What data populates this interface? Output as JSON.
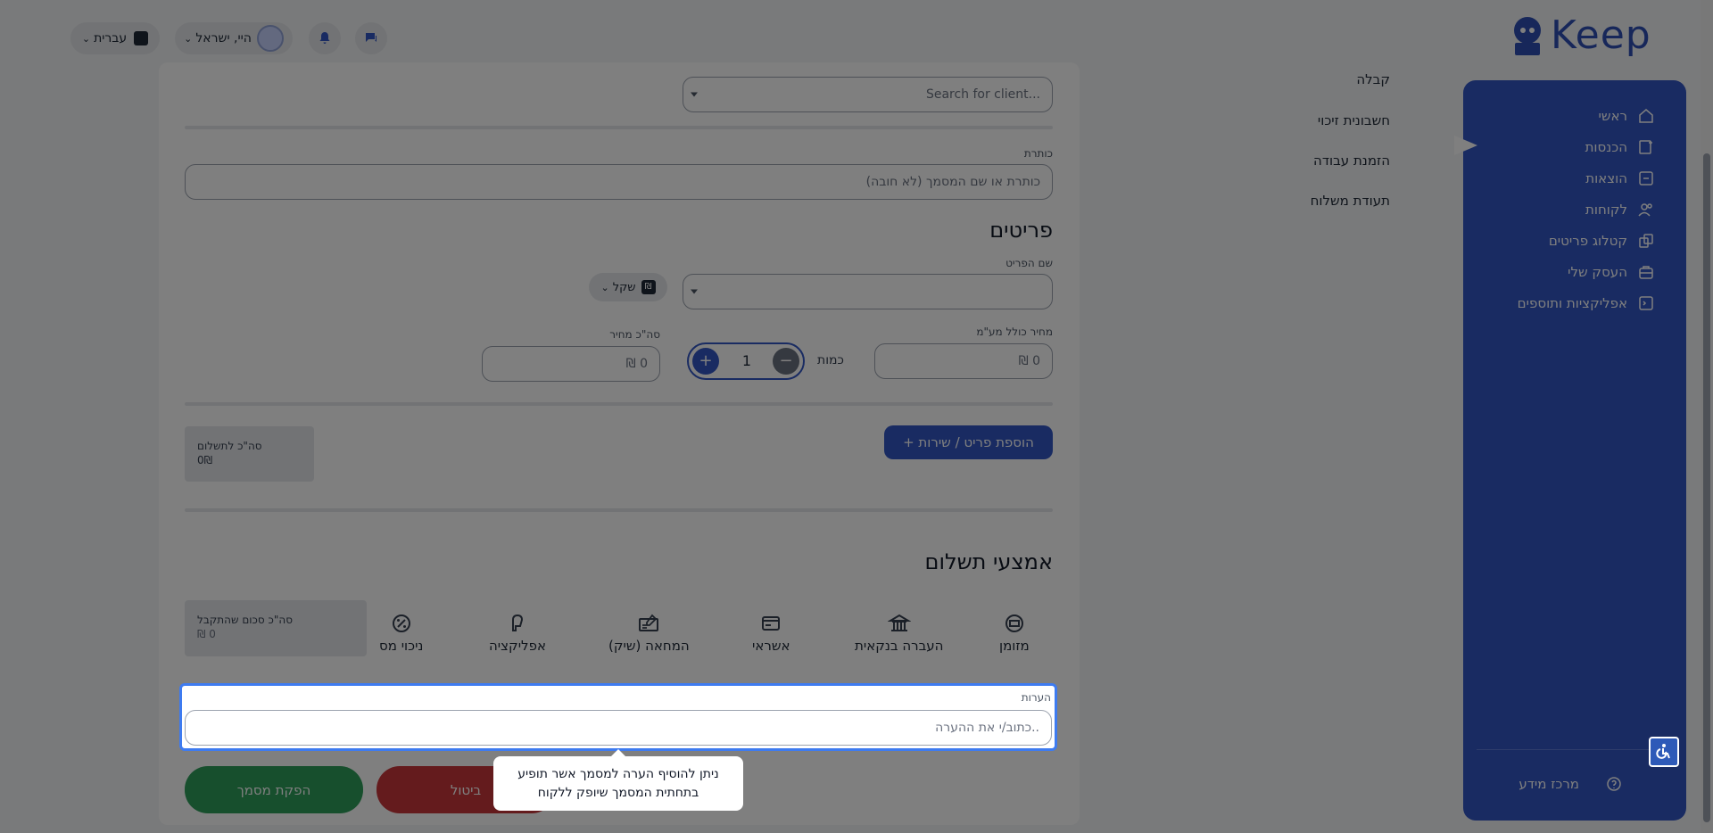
{
  "topbar": {
    "language_label": "עברית",
    "user_name": "היי, ישראל"
  },
  "brand": {
    "logo_text": "Keep"
  },
  "doc_types": [
    "קבלה",
    "חשבונית זיכוי",
    "הזמנת עבודה",
    "תעודת משלוח"
  ],
  "client": {
    "search_placeholder": "Search for client..."
  },
  "title_field": {
    "label": "כותרת",
    "placeholder": "(לא חובה) כותרת או שם המסמך"
  },
  "items": {
    "heading": "פריטים",
    "name_label": "שם הפריט",
    "currency_label": "שקל",
    "price_label": "מחיר כולל מע\"מ",
    "price_value": "₪ 0",
    "quantity_label": "כמות",
    "quantity_value": "1",
    "total_label": "סה\"כ מחיר",
    "total_value": "₪ 0",
    "add_button": "+ הוספת פריט / שירות",
    "sum_label": "סה\"כ לתשלום",
    "sum_value": "0₪"
  },
  "payment": {
    "heading": "אמצעי תשלום",
    "methods": [
      "מזומן",
      "העברה בנקאית",
      "אשראי",
      "המחאה (שיק)",
      "אפליקציה",
      "ניכוי מס"
    ],
    "received_label": "סה\"כ סכום שהתקבל",
    "received_value": "₪ 0"
  },
  "notes": {
    "label": "הערות",
    "placeholder": "כתוב/י את ההערה..",
    "tooltip": "ניתן להוסיף הערה למסמך אשר תופיע בתחתית המסמך שיופק ללקוח"
  },
  "actions": {
    "cancel": "ביטול",
    "issue": "הפקת מסמך"
  },
  "sidebar": {
    "items": [
      "ראשי",
      "הכנסות",
      "הוצאות",
      "לקוחות",
      "קטלוג פריטים",
      "העסק שלי",
      "אפליקציות ותוספים"
    ],
    "info_center": "מרכז מידע"
  },
  "colors": {
    "accent": "#3257c5",
    "danger": "#c8363b",
    "success": "#2e9e5b",
    "focus": "#3e7bf0"
  }
}
